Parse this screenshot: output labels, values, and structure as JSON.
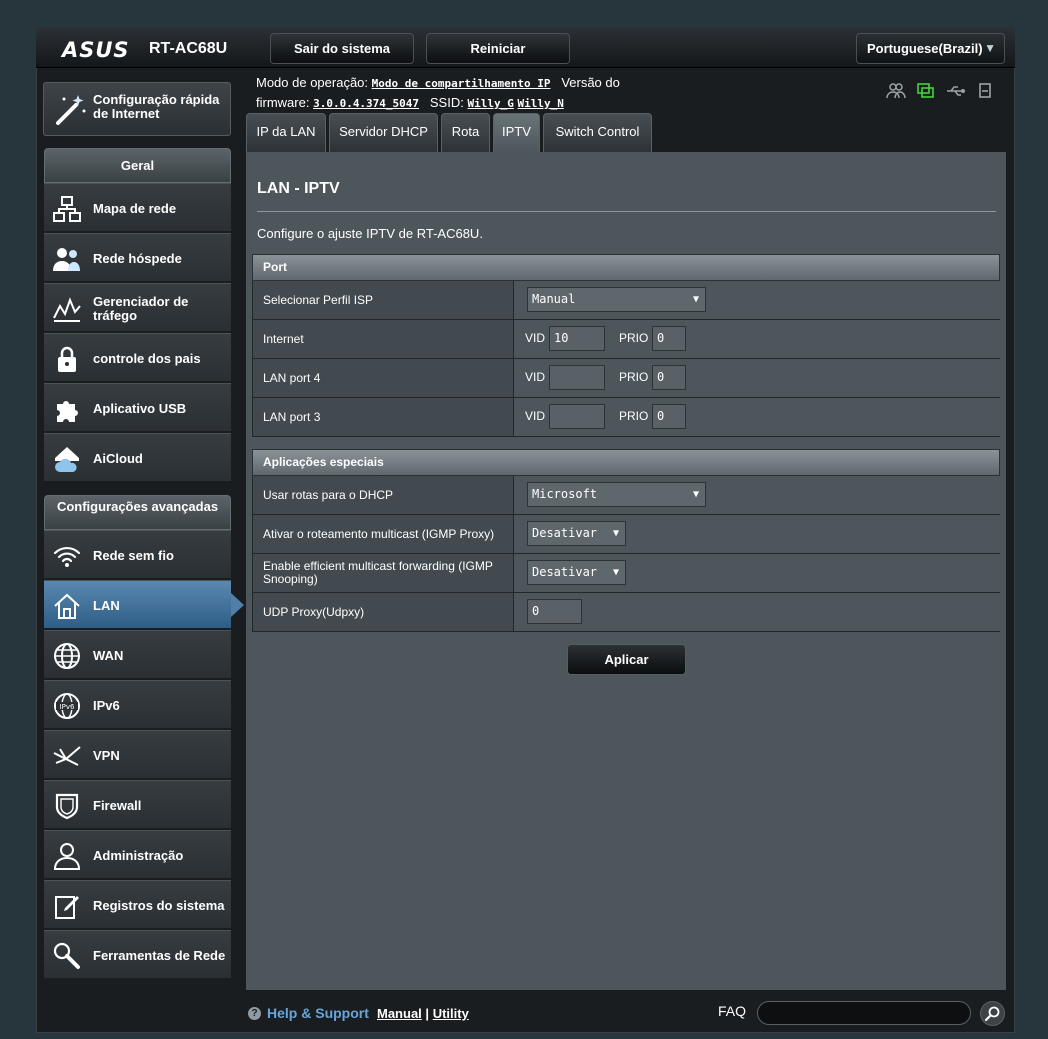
{
  "header": {
    "logo": "ASUS",
    "model": "RT-AC68U",
    "logout_label": "Sair do sistema",
    "reboot_label": "Reiniciar",
    "language": "Portuguese(Brazil)"
  },
  "status": {
    "mode_label": "Modo de operação:",
    "mode_value": "Modo de compartilhamento IP",
    "fw_label_1": "Versão do",
    "fw_label_2": "firmware:",
    "fw_value": "3.0.0.4.374_5047",
    "ssid_label": "SSID:",
    "ssid_1": "Willy_G",
    "ssid_2": "Willy_N"
  },
  "quick_setup": {
    "label_1": "Configuração rápida",
    "label_2": "de Internet"
  },
  "menu": {
    "general_title": "Geral",
    "general_items": [
      {
        "label": "Mapa de rede"
      },
      {
        "label": "Rede hóspede"
      },
      {
        "label": "Gerenciador de tráfego"
      },
      {
        "label": "controle dos pais"
      },
      {
        "label": "Aplicativo USB"
      },
      {
        "label": "AiCloud"
      }
    ],
    "advanced_title": "Configurações avançadas",
    "advanced_items": [
      {
        "label": "Rede sem fio"
      },
      {
        "label": "LAN"
      },
      {
        "label": "WAN"
      },
      {
        "label": "IPv6"
      },
      {
        "label": "VPN"
      },
      {
        "label": "Firewall"
      },
      {
        "label": "Administração"
      },
      {
        "label": "Registros do sistema"
      },
      {
        "label": "Ferramentas de Rede"
      }
    ]
  },
  "tabs": [
    {
      "label": "IP da LAN"
    },
    {
      "label": "Servidor DHCP"
    },
    {
      "label": "Rota"
    },
    {
      "label": "IPTV"
    },
    {
      "label": "Switch Control"
    }
  ],
  "content": {
    "title": "LAN - IPTV",
    "description": "Configure o ajuste IPTV de RT-AC68U.",
    "port_section": "Port",
    "isp_label": "Selecionar Perfil ISP",
    "isp_value": "Manual",
    "vid_label": "VID",
    "prio_label": "PRIO",
    "ports": [
      {
        "label": "Internet",
        "vid": "10",
        "prio": "0"
      },
      {
        "label": "LAN port 4",
        "vid": "",
        "prio": "0"
      },
      {
        "label": "LAN port 3",
        "vid": "",
        "prio": "0"
      }
    ],
    "special_section": "Aplicações especiais",
    "dhcp_routes_label": "Usar rotas para o DHCP",
    "dhcp_routes_value": "Microsoft",
    "igmp_proxy_label": "Ativar o roteamento multicast (IGMP Proxy)",
    "igmp_proxy_value": "Desativar",
    "igmp_snoop_label": "Enable efficient multicast forwarding (IGMP Snooping)",
    "igmp_snoop_value": "Desativar",
    "udpxy_label": "UDP Proxy(Udpxy)",
    "udpxy_value": "0",
    "apply_label": "Aplicar"
  },
  "footer": {
    "help_label": "Help & Support",
    "manual_label": "Manual",
    "separator": "|",
    "utility_label": "Utility",
    "faq_label": "FAQ"
  },
  "colors": {
    "accent_active": "#4f7fa9",
    "panel_bg": "#4d565b",
    "help_link": "#69a5d9",
    "status_icon_active": "#45d33e"
  }
}
